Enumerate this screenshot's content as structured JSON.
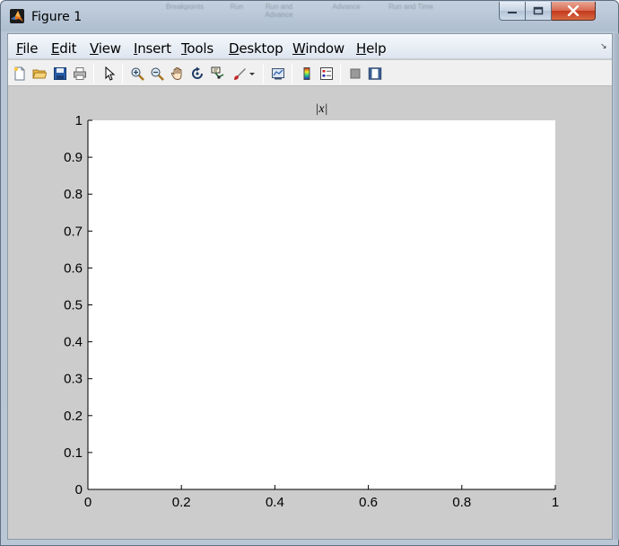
{
  "window": {
    "title": "Figure 1"
  },
  "background_ghost": [
    {
      "text": "Breakpoints"
    },
    {
      "text": "Run"
    },
    {
      "text": "Run and\nAdvance"
    },
    {
      "text": "Advance"
    },
    {
      "text": "Run and\nTime"
    }
  ],
  "menu": {
    "items": [
      {
        "label": "File",
        "accel": "F",
        "rest": "ile"
      },
      {
        "label": "Edit",
        "accel": "E",
        "rest": "dit"
      },
      {
        "label": "View",
        "accel": "V",
        "rest": "iew"
      },
      {
        "label": "Insert",
        "accel": "I",
        "rest": "nsert"
      },
      {
        "label": "Tools",
        "accel": "T",
        "rest": "ools"
      },
      {
        "label": "Desktop",
        "accel": "D",
        "rest": "esktop"
      },
      {
        "label": "Window",
        "accel": "W",
        "rest": "indow"
      },
      {
        "label": "Help",
        "accel": "H",
        "rest": "elp"
      }
    ]
  },
  "toolbar": {
    "buttons": [
      {
        "name": "new-figure",
        "icon": "new-document-icon"
      },
      {
        "name": "open-file",
        "icon": "folder-open-icon"
      },
      {
        "name": "save-figure",
        "icon": "save-disk-icon"
      },
      {
        "name": "print-figure",
        "icon": "printer-icon"
      },
      {
        "name": "edit-plot",
        "icon": "pointer-arrow-icon"
      },
      {
        "name": "zoom-in",
        "icon": "zoom-in-icon"
      },
      {
        "name": "zoom-out",
        "icon": "zoom-out-icon"
      },
      {
        "name": "pan",
        "icon": "hand-icon"
      },
      {
        "name": "rotate-3d",
        "icon": "rotate-icon"
      },
      {
        "name": "data-cursor",
        "icon": "data-cursor-icon"
      },
      {
        "name": "brush",
        "icon": "brush-icon"
      },
      {
        "name": "link-plot",
        "icon": "link-plot-icon"
      },
      {
        "name": "insert-colorbar",
        "icon": "colorbar-icon"
      },
      {
        "name": "insert-legend",
        "icon": "legend-icon"
      },
      {
        "name": "hide-plot-tools",
        "icon": "hide-tools-icon"
      },
      {
        "name": "show-plot-tools",
        "icon": "show-tools-icon"
      }
    ]
  },
  "chart_data": {
    "type": "line",
    "title": "|x|",
    "xlabel": "",
    "ylabel": "",
    "xlim": [
      0,
      1
    ],
    "ylim": [
      0,
      1
    ],
    "xticks": [
      "0",
      "0.2",
      "0.4",
      "0.6",
      "0.8",
      "1"
    ],
    "yticks": [
      "0",
      "0.1",
      "0.2",
      "0.3",
      "0.4",
      "0.5",
      "0.6",
      "0.7",
      "0.8",
      "0.9",
      "1"
    ],
    "grid": false,
    "series": []
  },
  "colors": {
    "figure_background": "#cccccc",
    "axes_background": "#ffffff",
    "axis_color": "#000000"
  }
}
